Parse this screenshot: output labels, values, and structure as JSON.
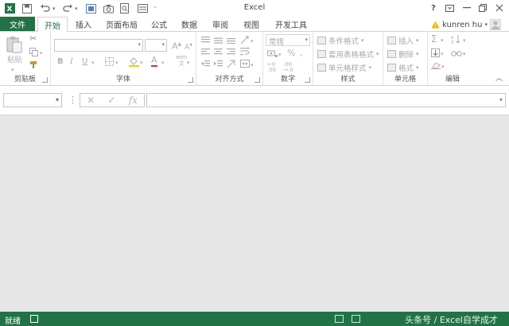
{
  "window": {
    "title": "Excel",
    "help": "?",
    "user": "kunren hu"
  },
  "tabs": [
    {
      "label": "文件"
    },
    {
      "label": "开始"
    },
    {
      "label": "插入"
    },
    {
      "label": "页面布局"
    },
    {
      "label": "公式"
    },
    {
      "label": "数据"
    },
    {
      "label": "审阅"
    },
    {
      "label": "视图"
    },
    {
      "label": "开发工具"
    }
  ],
  "active_tab": "开始",
  "ribbon": {
    "clipboard": {
      "label": "剪贴板",
      "paste": "粘贴"
    },
    "font": {
      "label": "字体",
      "bold": "B",
      "italic": "I",
      "underline": "U",
      "grow": "A",
      "shrink": "A",
      "font_color": "A",
      "wen": "wén"
    },
    "alignment": {
      "label": "对齐方式"
    },
    "number": {
      "label": "数字",
      "format": "常规",
      "percent": "%"
    },
    "styles": {
      "label": "样式",
      "conditional": "条件格式",
      "table": "套用表格格式",
      "cell_styles": "单元格样式"
    },
    "cells": {
      "label": "单元格",
      "insert": "插入",
      "delete": "删除",
      "format": "格式"
    },
    "editing": {
      "label": "编辑"
    }
  },
  "formula_bar": {
    "name_box": "",
    "formula": ""
  },
  "status": {
    "text": "就绪",
    "watermark": "头条号 / Excel自学成才"
  },
  "colors": {
    "accent": "#217346"
  }
}
